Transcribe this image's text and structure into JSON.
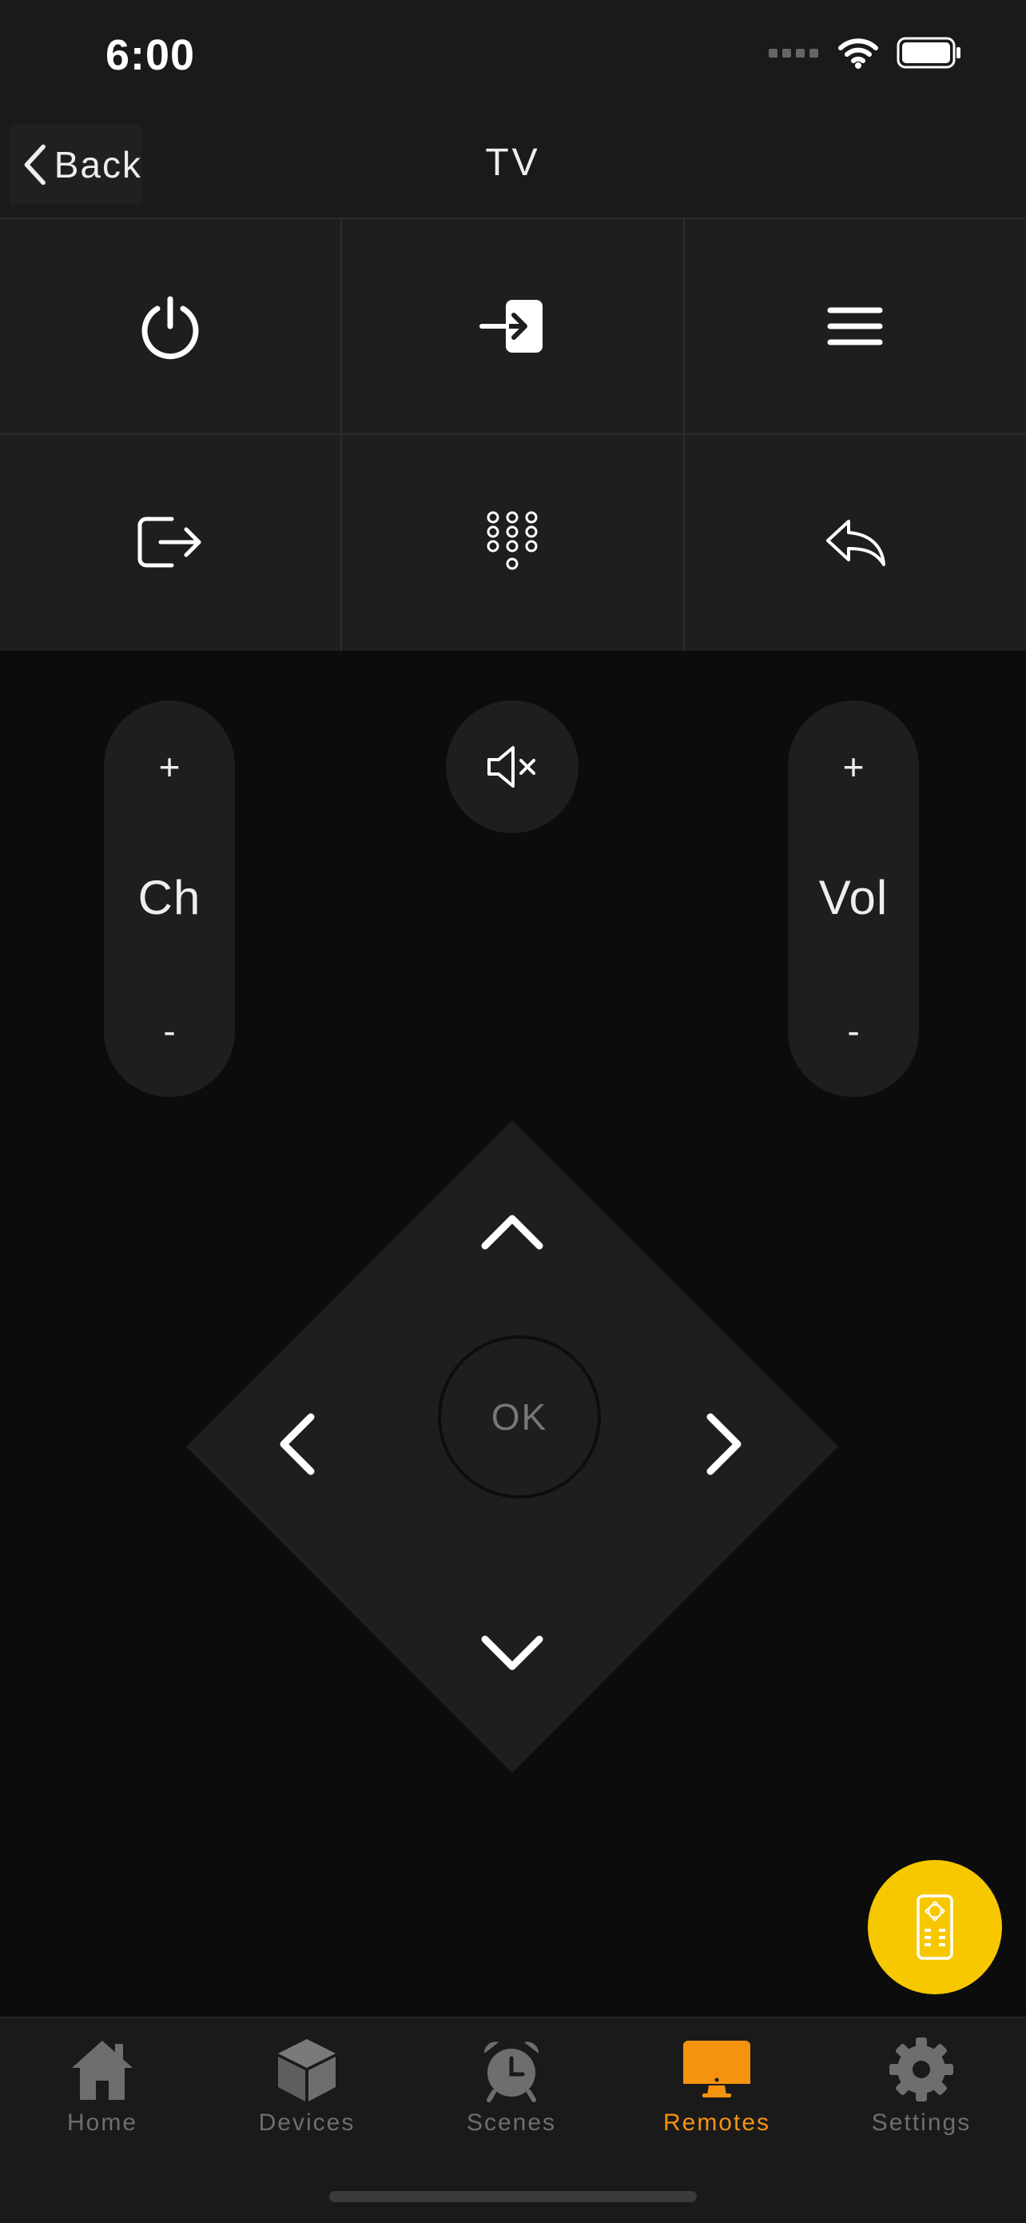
{
  "status_bar": {
    "time": "6:00"
  },
  "header": {
    "back_label": "Back",
    "title": "TV"
  },
  "control_grid": [
    {
      "icon": "power-icon"
    },
    {
      "icon": "input-source-icon"
    },
    {
      "icon": "menu-icon"
    },
    {
      "icon": "exit-icon"
    },
    {
      "icon": "numpad-icon"
    },
    {
      "icon": "return-icon"
    }
  ],
  "channel": {
    "plus": "+",
    "label": "Ch",
    "minus": "-"
  },
  "volume": {
    "plus": "+",
    "label": "Vol",
    "minus": "-"
  },
  "mute": {
    "icon": "mute-icon"
  },
  "dpad": {
    "ok_label": "OK"
  },
  "fab": {
    "icon": "remote-icon",
    "color": "#f7c800"
  },
  "tabs": [
    {
      "label": "Home",
      "icon": "home-icon",
      "active": false
    },
    {
      "label": "Devices",
      "icon": "cube-icon",
      "active": false
    },
    {
      "label": "Scenes",
      "icon": "alarm-clock-icon",
      "active": false
    },
    {
      "label": "Remotes",
      "icon": "monitor-icon",
      "active": true
    },
    {
      "label": "Settings",
      "icon": "gear-icon",
      "active": false
    }
  ],
  "colors": {
    "accent": "#f5930f",
    "background": "#0c0c0c",
    "surface": "#1e1e1e",
    "inactive_tab": "#6e6e6e"
  }
}
